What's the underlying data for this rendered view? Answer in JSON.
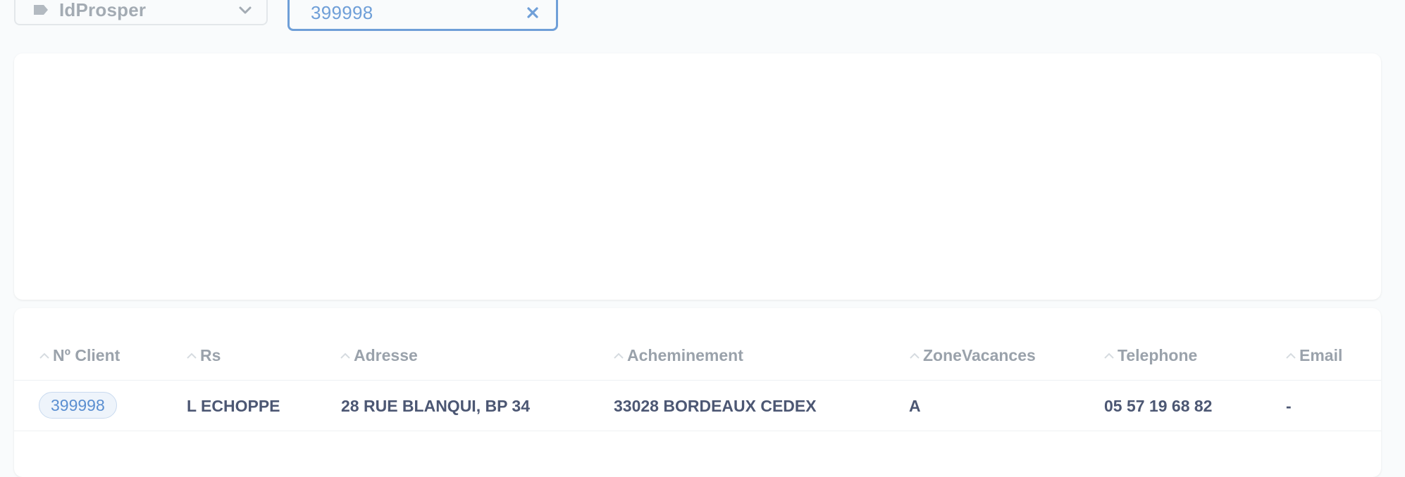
{
  "filters": {
    "field_select": {
      "label": "IdProsper",
      "icon": "tag-icon"
    },
    "value_input": {
      "value": "399998",
      "icon": "close-icon"
    }
  },
  "table": {
    "columns": [
      "Nº Client",
      "Rs",
      "Adresse",
      "Acheminement",
      "ZoneVacances",
      "Telephone",
      "Email"
    ],
    "rows": [
      {
        "client": "399998",
        "rs": "L ECHOPPE",
        "adresse": "28 RUE BLANQUI, BP 34",
        "acheminement": "33028 BORDEAUX CEDEX",
        "zone": "A",
        "telephone": "05 57 19 68 82",
        "email": "-"
      }
    ]
  },
  "colors": {
    "accent": "#6f9fd8",
    "muted_text": "#9aa2ab",
    "body_text": "#4c5773",
    "background": "#f9fbfc"
  }
}
